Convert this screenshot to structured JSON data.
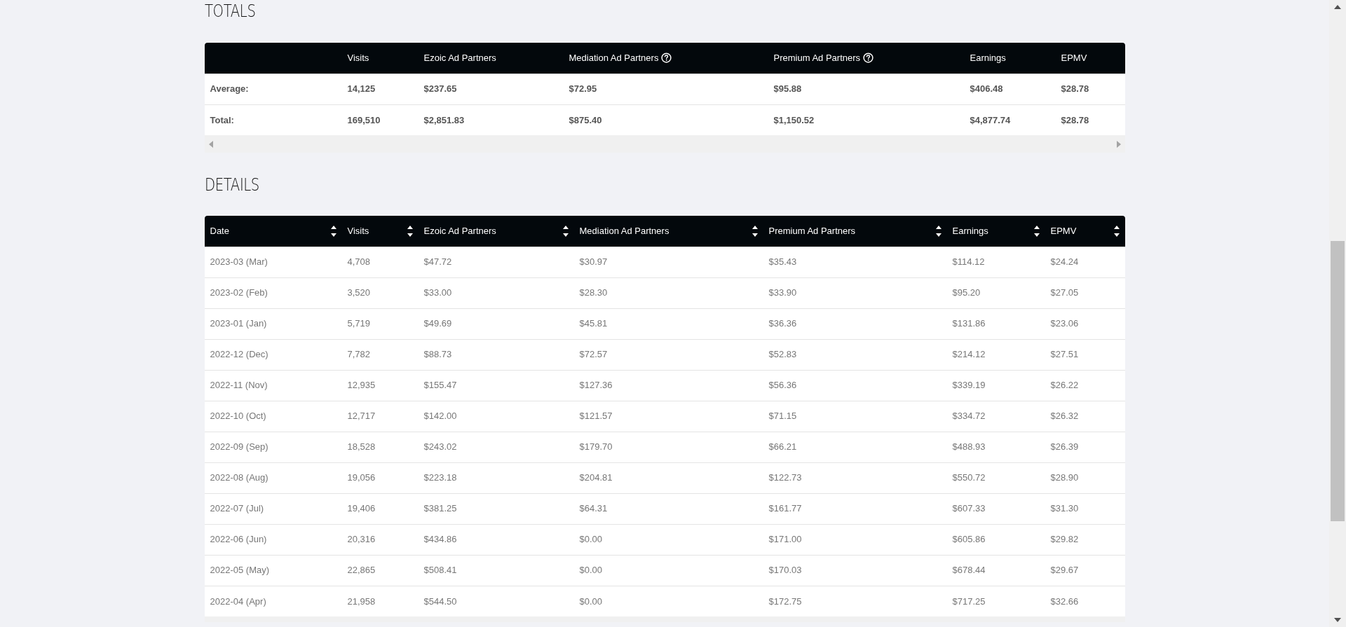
{
  "totals": {
    "heading": "TOTALS",
    "columns": [
      {
        "label": "Visits",
        "help": false
      },
      {
        "label": "Ezoic Ad Partners",
        "help": false
      },
      {
        "label": "Mediation Ad Partners",
        "help": true
      },
      {
        "label": "Premium Ad Partners",
        "help": true
      },
      {
        "label": "Earnings",
        "help": false
      },
      {
        "label": "EPMV",
        "help": false
      }
    ],
    "rows": [
      {
        "label": "Average:",
        "values": [
          "14,125",
          "$237.65",
          "$72.95",
          "$95.88",
          "$406.48",
          "$28.78"
        ]
      },
      {
        "label": "Total:",
        "values": [
          "169,510",
          "$2,851.83",
          "$875.40",
          "$1,150.52",
          "$4,877.74",
          "$28.78"
        ]
      }
    ]
  },
  "details": {
    "heading": "DETAILS",
    "columns": [
      "Date",
      "Visits",
      "Ezoic Ad Partners",
      "Mediation Ad Partners",
      "Premium Ad Partners",
      "Earnings",
      "EPMV"
    ],
    "rows": [
      [
        "2023-03 (Mar)",
        "4,708",
        "$47.72",
        "$30.97",
        "$35.43",
        "$114.12",
        "$24.24"
      ],
      [
        "2023-02 (Feb)",
        "3,520",
        "$33.00",
        "$28.30",
        "$33.90",
        "$95.20",
        "$27.05"
      ],
      [
        "2023-01 (Jan)",
        "5,719",
        "$49.69",
        "$45.81",
        "$36.36",
        "$131.86",
        "$23.06"
      ],
      [
        "2022-12 (Dec)",
        "7,782",
        "$88.73",
        "$72.57",
        "$52.83",
        "$214.12",
        "$27.51"
      ],
      [
        "2022-11 (Nov)",
        "12,935",
        "$155.47",
        "$127.36",
        "$56.36",
        "$339.19",
        "$26.22"
      ],
      [
        "2022-10 (Oct)",
        "12,717",
        "$142.00",
        "$121.57",
        "$71.15",
        "$334.72",
        "$26.32"
      ],
      [
        "2022-09 (Sep)",
        "18,528",
        "$243.02",
        "$179.70",
        "$66.21",
        "$488.93",
        "$26.39"
      ],
      [
        "2022-08 (Aug)",
        "19,056",
        "$223.18",
        "$204.81",
        "$122.73",
        "$550.72",
        "$28.90"
      ],
      [
        "2022-07 (Jul)",
        "19,406",
        "$381.25",
        "$64.31",
        "$161.77",
        "$607.33",
        "$31.30"
      ],
      [
        "2022-06 (Jun)",
        "20,316",
        "$434.86",
        "$0.00",
        "$171.00",
        "$605.86",
        "$29.82"
      ],
      [
        "2022-05 (May)",
        "22,865",
        "$508.41",
        "$0.00",
        "$170.03",
        "$678.44",
        "$29.67"
      ],
      [
        "2022-04 (Apr)",
        "21,958",
        "$544.50",
        "$0.00",
        "$172.75",
        "$717.25",
        "$32.66"
      ]
    ]
  }
}
